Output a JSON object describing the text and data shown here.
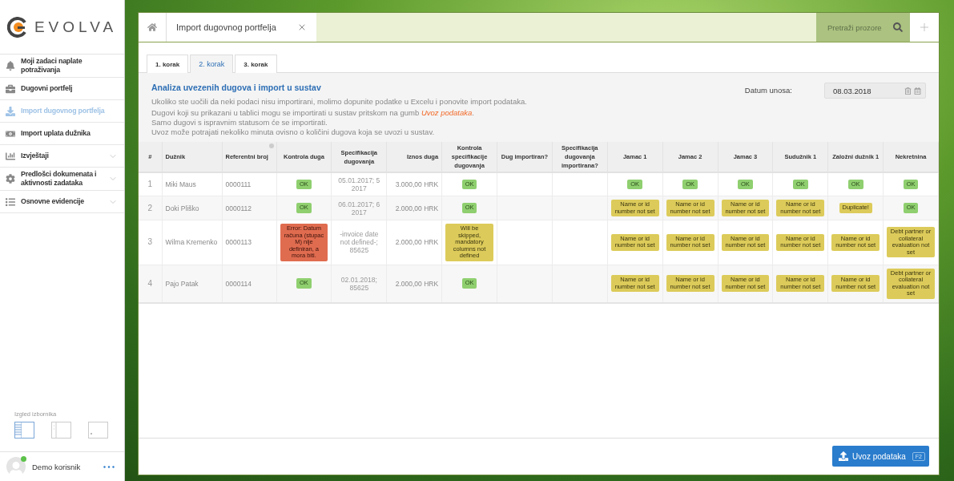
{
  "sidebar": {
    "logo": "EVOLVA",
    "menu": [
      {
        "label": "Moji zadaci naplate potraživanja",
        "selected": false,
        "kind": "link"
      },
      {
        "label": "Dugovni portfelj",
        "selected": false,
        "kind": "link"
      },
      {
        "label": "Import dugovnog portfelja",
        "selected": true,
        "kind": "link"
      },
      {
        "label": "Import uplata dužnika",
        "selected": false,
        "kind": "link"
      },
      {
        "label": "Izvještaji",
        "selected": false,
        "kind": "group"
      },
      {
        "label": "Predlošci dokumenata i aktivnosti zadataka",
        "selected": false,
        "kind": "group"
      },
      {
        "label": "Osnovne evidencije",
        "selected": false,
        "kind": "group"
      }
    ],
    "layout_label": "Izgled izbornika",
    "layout_options": [
      {
        "selected": true
      },
      {
        "selected": false
      },
      {
        "selected": false
      }
    ],
    "user": {
      "name": "Demo korisnik",
      "online": true
    }
  },
  "tabs": [
    {
      "label": "Import dugovnog portfelja",
      "selected": true
    }
  ],
  "search": {
    "placeholder": "Pretraži prozore"
  },
  "steps": [
    {
      "label": "1. korak",
      "selected": false
    },
    {
      "label": "2. korak",
      "selected": true
    },
    {
      "label": "3. korak",
      "selected": false
    }
  ],
  "info": {
    "title": "Analiza uvezenih dugova i import u sustav",
    "lines": [
      {
        "text": "Ukoliko ste uočili da neki podaci nisu importirani, molimo dopunite podatke u Excelu i ponovite import podataka."
      },
      {
        "text": "Dugovi koji su prikazani u tablici mogu se importirati u sustav pritskom na gumb ",
        "link": "Uvoz podataka",
        "after": "."
      },
      {
        "text": "Samo dugovi s ispravnim statusom će se importirati."
      },
      {
        "text": "Uvoz može potrajati nekoliko minuta ovisno o količini dugova koja se uvozi u sustav."
      }
    ]
  },
  "date": {
    "label": "Datum unosa:",
    "value": "08.03.2018"
  },
  "table": {
    "columns": [
      {
        "label": "#"
      },
      {
        "label": "Dužnik"
      },
      {
        "label": "Referentni broj",
        "menu_icon": true
      },
      {
        "label": "Kontrola duga"
      },
      {
        "label": "Specifikacija dugovanja"
      },
      {
        "label": "Iznos duga"
      },
      {
        "label": "Kontrola specifikacije dugovanja"
      },
      {
        "label": "Dug importiran?"
      },
      {
        "label": "Specifikacija dugovanja importirana?"
      },
      {
        "label": "Jamac 1"
      },
      {
        "label": "Jamac 2"
      },
      {
        "label": "Jamac 3"
      },
      {
        "label": "Sudužnik 1"
      },
      {
        "label": "Založni dužnik 1"
      },
      {
        "label": "Nekretnina"
      }
    ],
    "rows": [
      {
        "cells": [
          {
            "kind": "index",
            "text": "1"
          },
          {
            "kind": "text",
            "text": "Miki Maus"
          },
          {
            "kind": "text",
            "text": "0000111"
          },
          {
            "kind": "ok",
            "text": "OK"
          },
          {
            "kind": "spec",
            "text": "05.01.2017; 5 2017"
          },
          {
            "kind": "amount",
            "text": "3.000,00 HRK"
          },
          {
            "kind": "ok",
            "text": "OK"
          },
          {
            "kind": "empty"
          },
          {
            "kind": "empty"
          },
          {
            "kind": "ok",
            "text": "OK"
          },
          {
            "kind": "ok",
            "text": "OK"
          },
          {
            "kind": "ok",
            "text": "OK"
          },
          {
            "kind": "ok",
            "text": "OK"
          },
          {
            "kind": "ok",
            "text": "OK"
          },
          {
            "kind": "ok",
            "text": "OK"
          }
        ]
      },
      {
        "cells": [
          {
            "kind": "index",
            "text": "2"
          },
          {
            "kind": "text",
            "text": "Doki Pliško"
          },
          {
            "kind": "text",
            "text": "0000112"
          },
          {
            "kind": "ok",
            "text": "OK"
          },
          {
            "kind": "spec",
            "text": "06.01.2017; 6 2017"
          },
          {
            "kind": "amount",
            "text": "2.000,00 HRK"
          },
          {
            "kind": "ok",
            "text": "OK"
          },
          {
            "kind": "empty"
          },
          {
            "kind": "empty"
          },
          {
            "kind": "warn",
            "text": "Name or id number not set"
          },
          {
            "kind": "warn",
            "text": "Name or id number not set"
          },
          {
            "kind": "warn",
            "text": "Name or id number not set"
          },
          {
            "kind": "warn",
            "text": "Name or id number not set"
          },
          {
            "kind": "warn",
            "text": "Duplicate!"
          },
          {
            "kind": "ok",
            "text": "OK"
          }
        ]
      },
      {
        "cells": [
          {
            "kind": "index",
            "text": "3"
          },
          {
            "kind": "text",
            "text": "Wilma Kremenko"
          },
          {
            "kind": "text",
            "text": "0000113"
          },
          {
            "kind": "error",
            "text": "Error: Datum računa (stupac M) nije definiran, a mora biti."
          },
          {
            "kind": "spec",
            "text": "-invoice date not defined-; 85625"
          },
          {
            "kind": "amount",
            "text": "2.000,00 HRK"
          },
          {
            "kind": "warn",
            "text": "Will be skipped, mandatory columns not defined"
          },
          {
            "kind": "empty"
          },
          {
            "kind": "empty"
          },
          {
            "kind": "warn",
            "text": "Name or id number not set"
          },
          {
            "kind": "warn",
            "text": "Name or id number not set"
          },
          {
            "kind": "warn",
            "text": "Name or id number not set"
          },
          {
            "kind": "warn",
            "text": "Name or id number not set"
          },
          {
            "kind": "warn",
            "text": "Name or id number not set"
          },
          {
            "kind": "warn",
            "text": "Debt partner or collateral evaluation not set"
          }
        ]
      },
      {
        "cells": [
          {
            "kind": "index",
            "text": "4"
          },
          {
            "kind": "text",
            "text": "Pajo Patak"
          },
          {
            "kind": "text",
            "text": "0000114"
          },
          {
            "kind": "ok",
            "text": "OK"
          },
          {
            "kind": "spec",
            "text": "02.01.2018; 85625"
          },
          {
            "kind": "amount",
            "text": "2.000,00 HRK"
          },
          {
            "kind": "ok",
            "text": "OK"
          },
          {
            "kind": "empty"
          },
          {
            "kind": "empty"
          },
          {
            "kind": "warn",
            "text": "Name or id number not set"
          },
          {
            "kind": "warn",
            "text": "Name or id number not set"
          },
          {
            "kind": "warn",
            "text": "Name or id number not set"
          },
          {
            "kind": "warn",
            "text": "Name or id number not set"
          },
          {
            "kind": "warn",
            "text": "Name or id number not set"
          },
          {
            "kind": "warn",
            "text": "Debt partner or collateral evaluation not set"
          }
        ]
      }
    ]
  },
  "import_button": {
    "label": "Uvoz podataka",
    "shortcut": "F2"
  }
}
